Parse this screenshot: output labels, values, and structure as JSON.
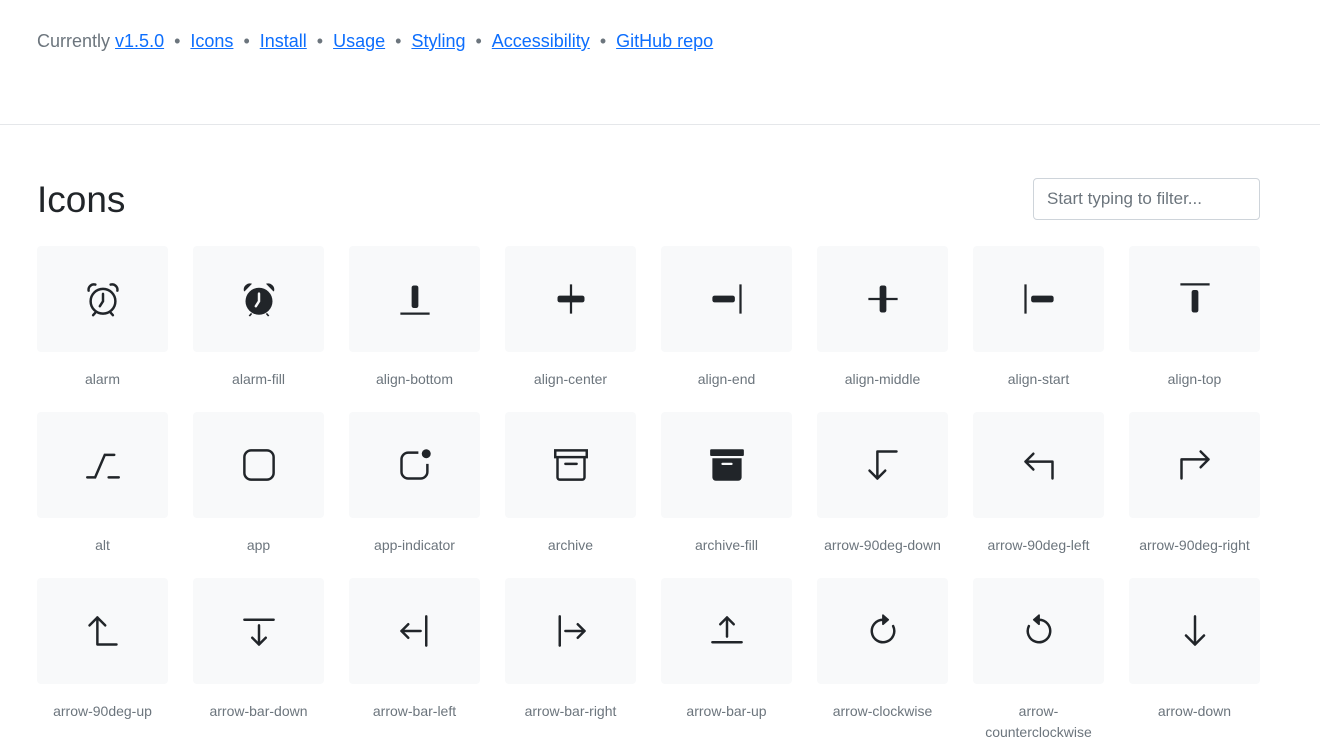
{
  "topnav": {
    "prefix": "Currently",
    "links": [
      "v1.5.0",
      "Icons",
      "Install",
      "Usage",
      "Styling",
      "Accessibility",
      "GitHub repo"
    ]
  },
  "page_title": "Icons",
  "filter": {
    "placeholder": "Start typing to filter...",
    "value": ""
  },
  "icons": [
    {
      "label": "alarm",
      "icon": "alarm-icon"
    },
    {
      "label": "alarm-fill",
      "icon": "alarm-fill-icon"
    },
    {
      "label": "align-bottom",
      "icon": "align-bottom-icon"
    },
    {
      "label": "align-center",
      "icon": "align-center-icon"
    },
    {
      "label": "align-end",
      "icon": "align-end-icon"
    },
    {
      "label": "align-middle",
      "icon": "align-middle-icon"
    },
    {
      "label": "align-start",
      "icon": "align-start-icon"
    },
    {
      "label": "align-top",
      "icon": "align-top-icon"
    },
    {
      "label": "alt",
      "icon": "alt-icon"
    },
    {
      "label": "app",
      "icon": "app-icon"
    },
    {
      "label": "app-indicator",
      "icon": "app-indicator-icon"
    },
    {
      "label": "archive",
      "icon": "archive-icon"
    },
    {
      "label": "archive-fill",
      "icon": "archive-fill-icon"
    },
    {
      "label": "arrow-90deg-down",
      "icon": "arrow-90deg-down-icon"
    },
    {
      "label": "arrow-90deg-left",
      "icon": "arrow-90deg-left-icon"
    },
    {
      "label": "arrow-90deg-right",
      "icon": "arrow-90deg-right-icon"
    },
    {
      "label": "arrow-90deg-up",
      "icon": "arrow-90deg-up-icon"
    },
    {
      "label": "arrow-bar-down",
      "icon": "arrow-bar-down-icon"
    },
    {
      "label": "arrow-bar-left",
      "icon": "arrow-bar-left-icon"
    },
    {
      "label": "arrow-bar-right",
      "icon": "arrow-bar-right-icon"
    },
    {
      "label": "arrow-bar-up",
      "icon": "arrow-bar-up-icon"
    },
    {
      "label": "arrow-clockwise",
      "icon": "arrow-clockwise-icon"
    },
    {
      "label": "arrow-counterclockwise",
      "icon": "arrow-counterclockwise-icon"
    },
    {
      "label": "arrow-down",
      "icon": "arrow-down-icon"
    }
  ],
  "colors": {
    "link": "#0d6efd",
    "text": "#212529",
    "muted": "#6c757d",
    "tile_bg": "#f8f9fa",
    "border": "#ced4da"
  }
}
